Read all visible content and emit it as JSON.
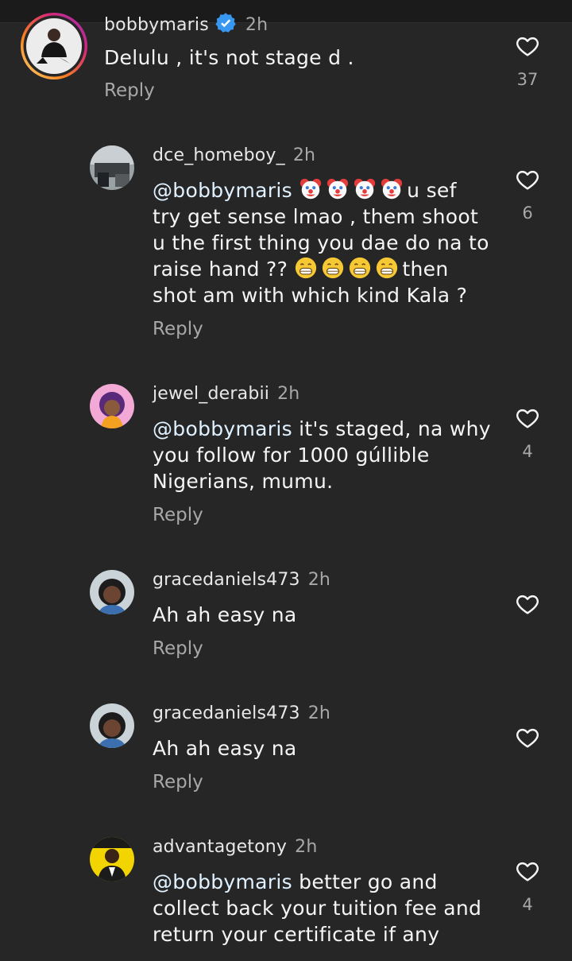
{
  "colors": {
    "background": "#262626",
    "text": "#f5f5f5",
    "secondary": "#a8a8a8",
    "mention": "#e0f1ff",
    "verified": "#3897f0",
    "story_ring": [
      "#feda75",
      "#fa7e1e",
      "#d62976",
      "#962fbf"
    ]
  },
  "icons": {
    "like": "heart-outline-icon",
    "verified": "verified-badge-icon",
    "clown": "clown-face-emoji",
    "grin": "grinning-face-emoji"
  },
  "comments": [
    {
      "username": "bobbymaris",
      "time": "2h",
      "verified": true,
      "text": "Delulu , it's not stage d .",
      "reply_label": "Reply",
      "likes": "37"
    },
    {
      "username": "dce_homeboy_",
      "time": "2h",
      "mention": "@bobbymaris",
      "lines": [
        "u sef",
        "try get sense lmao , them shoot",
        "u the first thing you dae do na to",
        "raise hand ??",
        "then",
        "shot am with which kind Kala ?"
      ],
      "reply_label": "Reply",
      "likes": "6"
    },
    {
      "username": "jewel_derabii",
      "time": "2h",
      "mention": "@bobbymaris",
      "lines": [
        "it's staged, na why",
        "you follow for 1000 gúllible",
        "Nigerians, mumu."
      ],
      "reply_label": "Reply",
      "likes": "4"
    },
    {
      "username": "gracedaniels473",
      "time": "2h",
      "text": "Ah ah easy na",
      "reply_label": "Reply"
    },
    {
      "username": "gracedaniels473",
      "time": "2h",
      "text": "Ah ah easy na",
      "reply_label": "Reply"
    },
    {
      "username": "advantagetony",
      "time": "2h",
      "mention": "@bobbymaris",
      "lines": [
        "better go and",
        "collect back your tuition fee and",
        "return your certificate if any"
      ],
      "likes": "4"
    }
  ]
}
